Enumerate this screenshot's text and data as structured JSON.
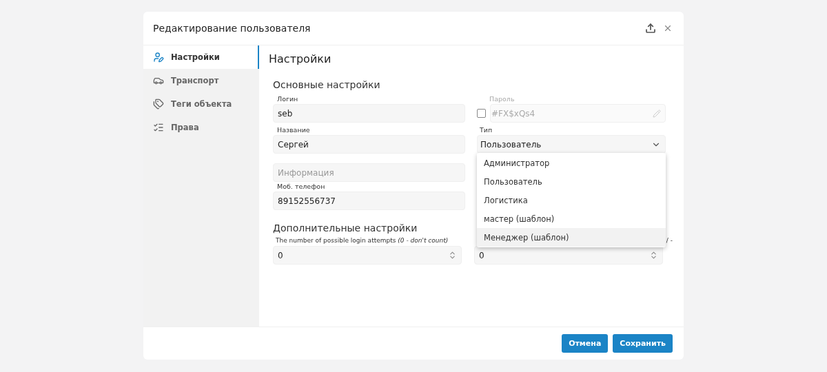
{
  "dialog": {
    "title": "Редактирование пользователя"
  },
  "sidebar": {
    "items": [
      {
        "label": "Настройки",
        "selected": true
      },
      {
        "label": "Транспорт",
        "selected": false
      },
      {
        "label": "Теги объекта",
        "selected": false
      },
      {
        "label": "Права",
        "selected": false
      }
    ]
  },
  "page_title": "Настройки",
  "main_section": {
    "title": "Основные настройки",
    "login": {
      "label": "Логин",
      "value": "seb"
    },
    "password": {
      "label": "Пароль",
      "value": "#FX$xQs4",
      "checked": false,
      "disabled": true
    },
    "name": {
      "label": "Название",
      "value": "Сергей"
    },
    "type": {
      "label": "Тип",
      "value": "Пользователь",
      "expanded": true,
      "options": [
        {
          "label": "Администратор",
          "highlighted": false
        },
        {
          "label": "Пользователь",
          "highlighted": false
        },
        {
          "label": "Логистика",
          "highlighted": false
        },
        {
          "label": "мастер (шаблон)",
          "highlighted": false
        },
        {
          "label": "Менеджер (шаблон)",
          "highlighted": true
        }
      ]
    },
    "info": {
      "placeholder": "Информация"
    },
    "phone": {
      "label": "Моб. телефон",
      "value": "89152556737"
    }
  },
  "extra_section": {
    "title": "Дополнительные настройки",
    "attempts": {
      "label": "The number of possible login attempts *(0 - don't count)*",
      "value": "0"
    },
    "column_2": {
      "label": "/ -",
      "value": "0"
    }
  },
  "buttons": [
    {
      "label": "Отмена"
    },
    {
      "label": "Сохранить"
    }
  ]
}
